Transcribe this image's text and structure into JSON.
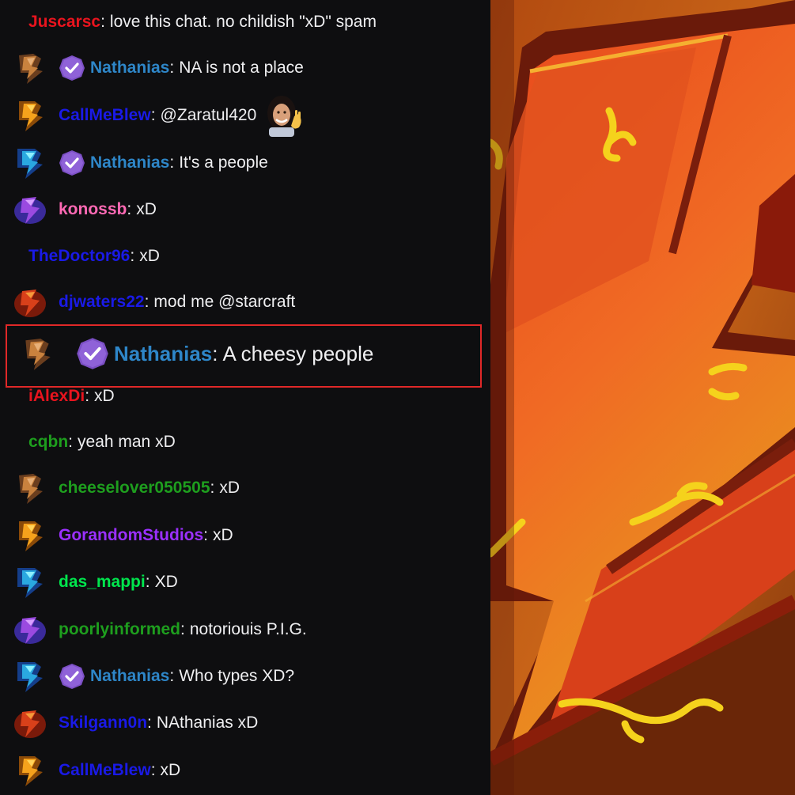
{
  "chat": {
    "messages": [
      {
        "badge": null,
        "mod": false,
        "user": "Juscarsc",
        "color": "#e8141e",
        "text": "love this chat. no childish \"xD\" spam"
      },
      {
        "badge": "bits-100",
        "mod": true,
        "user": "Nathanias",
        "color": "#2e86c8",
        "text": "NA is not a place"
      },
      {
        "badge": "bits-1000",
        "mod": false,
        "user": "CallMeBlew",
        "color": "#1a1ae6",
        "text": "@Zaratul420",
        "emote": "waving-woman-emote"
      },
      {
        "badge": "bits-5000",
        "mod": true,
        "user": "Nathanias",
        "color": "#2e86c8",
        "text": "It's a people"
      },
      {
        "badge": "bits-10000",
        "mod": false,
        "user": "konossb",
        "color": "#ff69b4",
        "text": "xD"
      },
      {
        "badge": null,
        "mod": false,
        "user": "TheDoctor96",
        "color": "#1a1ae6",
        "text": "xD"
      },
      {
        "badge": "bits-100000",
        "mod": false,
        "user": "djwaters22",
        "color": "#1a1ae6",
        "text": "mod me @starcraft"
      },
      {
        "badge": "bits-100",
        "mod": true,
        "user": "Nathanias",
        "color": "#2e86c8",
        "text": "A cheesy people",
        "highlighted": true
      },
      {
        "badge": null,
        "mod": false,
        "user": "iAlexDi",
        "color": "#e8141e",
        "text": "xD"
      },
      {
        "badge": null,
        "mod": false,
        "user": "cqbn",
        "color": "#1e9e1e",
        "text": "yeah man xD"
      },
      {
        "badge": "bits-100",
        "mod": false,
        "user": "cheeselover050505",
        "color": "#1e9e1e",
        "text": "xD"
      },
      {
        "badge": "bits-1000",
        "mod": false,
        "user": "GorandomStudios",
        "color": "#9b30ff",
        "text": "xD"
      },
      {
        "badge": "bits-5000",
        "mod": false,
        "user": "das_mappi",
        "color": "#00e64d",
        "text": "XD"
      },
      {
        "badge": "bits-10000",
        "mod": false,
        "user": "poorlyinformed",
        "color": "#1e9e1e",
        "text": "notoriouis P.I.G."
      },
      {
        "badge": "bits-5000",
        "mod": true,
        "user": "Nathanias",
        "color": "#2e86c8",
        "text": "Who types XD?"
      },
      {
        "badge": "bits-100000",
        "mod": false,
        "user": "Skilgann0n",
        "color": "#1a1ae6",
        "text": "NAthanias xD"
      },
      {
        "badge": "bits-1000",
        "mod": false,
        "user": "CallMeBlew",
        "color": "#1a1ae6",
        "text": "xD"
      }
    ]
  },
  "colors": {
    "background": "#0e0e10",
    "text": "#efeff1",
    "highlight_border": "#e02828",
    "mod_badge": "#7b4fc4"
  },
  "artwork": {
    "description_icon": "lightning-bolt-icon"
  }
}
